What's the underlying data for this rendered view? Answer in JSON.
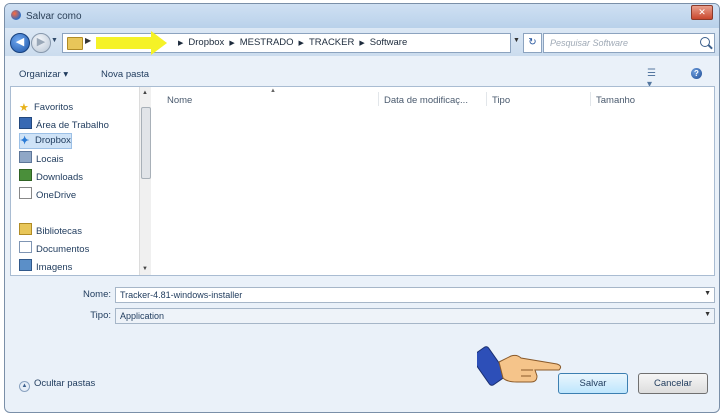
{
  "window": {
    "title": "Salvar como",
    "close_label": "✕"
  },
  "address": {
    "crumbs": [
      "Dropbox",
      "MESTRADO",
      "TRACKER",
      "Software"
    ],
    "search_placeholder": "Pesquisar Software"
  },
  "toolbar": {
    "organize_label": "Organizar ▾",
    "new_folder_label": "Nova pasta"
  },
  "nav": {
    "items": [
      {
        "label": "Favoritos",
        "icon": "star-icon"
      },
      {
        "label": "Área de Trabalho",
        "icon": "desktop-icon"
      },
      {
        "label": "Dropbox",
        "icon": "dropbox-icon"
      },
      {
        "label": "Locais",
        "icon": "places-icon"
      },
      {
        "label": "Downloads",
        "icon": "downloads-icon"
      },
      {
        "label": "OneDrive",
        "icon": "onedrive-icon"
      },
      {
        "label": "Bibliotecas",
        "icon": "library-icon"
      },
      {
        "label": "Documentos",
        "icon": "documents-icon"
      },
      {
        "label": "Imagens",
        "icon": "images-icon"
      }
    ]
  },
  "columns": {
    "name": "Nome",
    "date": "Data de modificaç...",
    "type": "Tipo",
    "size": "Tamanho"
  },
  "fields": {
    "name_label": "Nome:",
    "name_value": "Tracker-4.81-windows-installer",
    "type_label": "Tipo:",
    "type_value": "Application"
  },
  "footer": {
    "hide_folders_label": "Ocultar pastas",
    "save_label": "Salvar",
    "cancel_label": "Cancelar"
  },
  "colors": {
    "arrow": "#f5f227",
    "selection": "#cfe3f7",
    "hand": "#f5c48a",
    "sleeve": "#2d4fb8"
  }
}
